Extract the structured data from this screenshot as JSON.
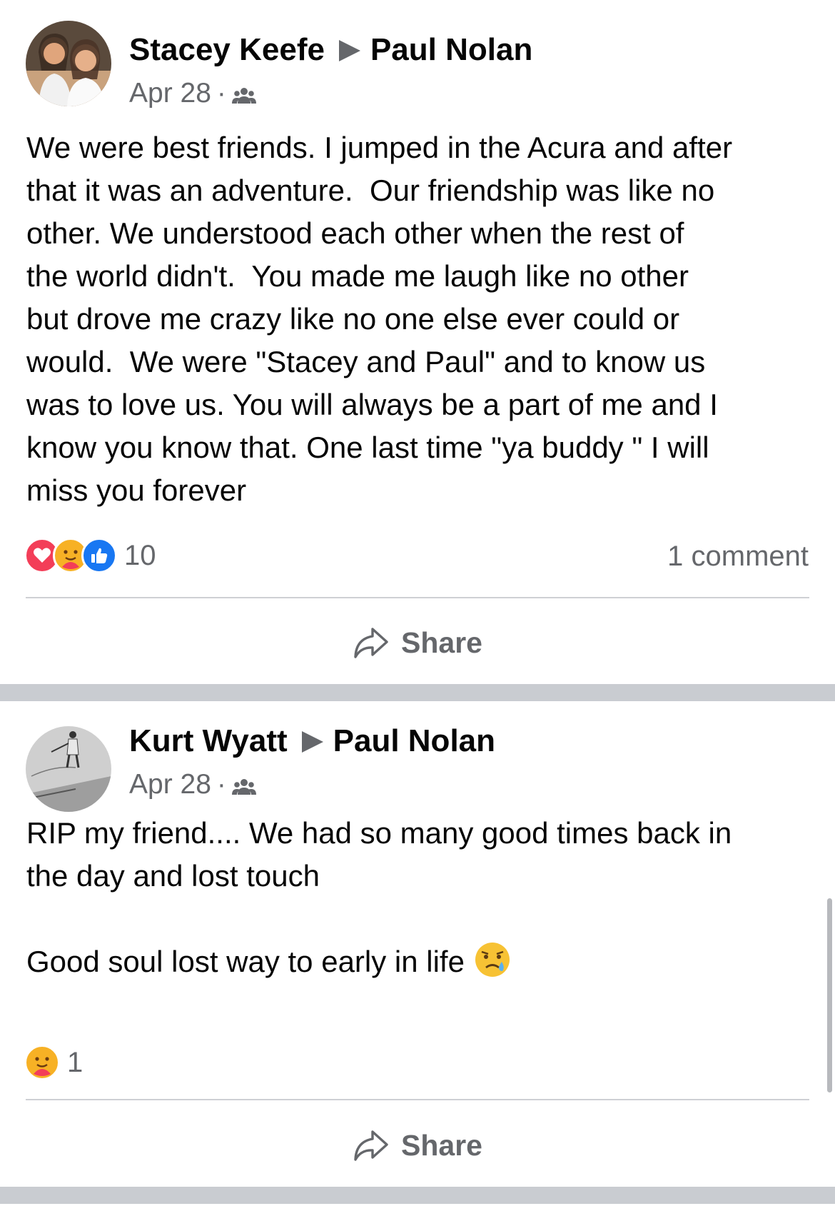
{
  "posts": [
    {
      "author": "Stacey Keefe",
      "recipient": "Paul Nolan",
      "date": "Apr 28",
      "audience_icon": "friends-icon",
      "text": "We were best friends. I jumped in the Acura and after\nthat it was an adventure.  Our friendship was like no\nother. We understood each other when the rest of\nthe world didn't.  You made me laugh like no other\nbut drove me crazy like no one else ever could or\nwould.  We were \"Stacey and Paul\" and to know us\nwas to love us. You will always be a part of me and I\nknow you know that. One last time \"ya buddy \" I will\nmiss you forever",
      "reactions": [
        "love",
        "care",
        "like"
      ],
      "reaction_count": "10",
      "comment_count": "1 comment",
      "share_label": "Share"
    },
    {
      "author": "Kurt Wyatt",
      "recipient": "Paul Nolan",
      "date": "Apr 28",
      "audience_icon": "friends-icon",
      "text": "RIP my friend.... We had so many good times back in\nthe day and lost touch\n\nGood soul lost way to early in life",
      "text_emoji": "sad-tear-emoji",
      "reactions": [
        "care"
      ],
      "reaction_count": "1",
      "share_label": "Share"
    }
  ],
  "colors": {
    "text_primary": "#050505",
    "text_secondary": "#65676b",
    "love": "#f33e58",
    "like": "#1877f2",
    "care": "#f7b125",
    "divider": "#c9ccd1"
  }
}
